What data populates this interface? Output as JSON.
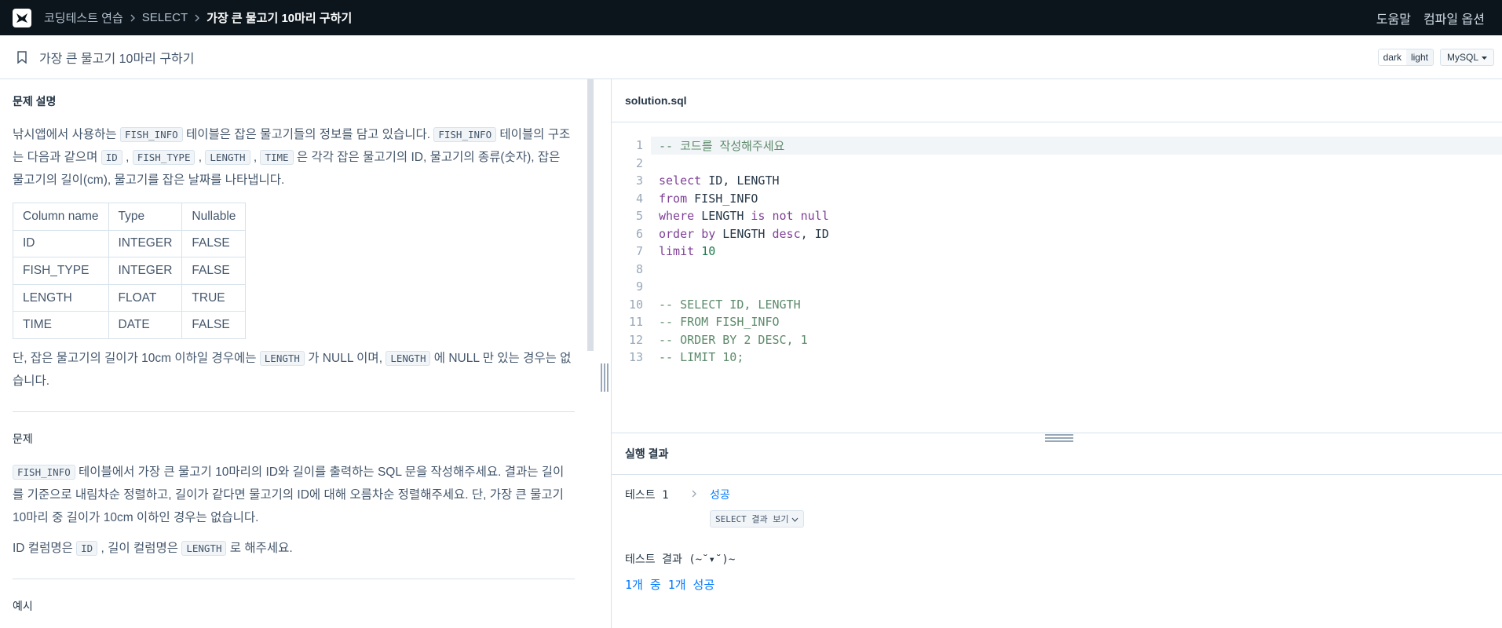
{
  "nav": {
    "breadcrumbs": [
      "코딩테스트 연습",
      "SELECT",
      "가장 큰 물고기 10마리 구하기"
    ],
    "help": "도움말",
    "compile_options": "컴파일 옵션"
  },
  "titlebar": {
    "title": "가장 큰 물고기 10마리 구하기",
    "theme_dark": "dark",
    "theme_light": "light",
    "language": "MySQL"
  },
  "problem": {
    "section_desc": "문제 설명",
    "p1_a": "낚시앱에서 사용하는 ",
    "p1_code1": "FISH_INFO",
    "p1_b": " 테이블은 잡은 물고기들의 정보를 담고 있습니다. ",
    "p1_code2": "FISH_INFO",
    "p1_c": " 테이블의 구조는 다음과 같으며 ",
    "p1_code3": "ID",
    "p1_d": " , ",
    "p1_code4": "FISH_TYPE",
    "p1_e": " , ",
    "p1_code5": "LENGTH",
    "p1_f": " , ",
    "p1_code6": "TIME",
    "p1_g": " 은 각각 잡은 물고기의 ID, 물고기의 종류(숫자), 잡은 물고기의 길이(cm), 물고기를 잡은 날짜를 나타냅니다.",
    "table_headers": [
      "Column name",
      "Type",
      "Nullable"
    ],
    "table_rows": [
      [
        "ID",
        "INTEGER",
        "FALSE"
      ],
      [
        "FISH_TYPE",
        "INTEGER",
        "FALSE"
      ],
      [
        "LENGTH",
        "FLOAT",
        "TRUE"
      ],
      [
        "TIME",
        "DATE",
        "FALSE"
      ]
    ],
    "p2_a": "단, 잡은 물고기의 길이가 10cm 이하일 경우에는 ",
    "p2_code1": "LENGTH",
    "p2_b": " 가 NULL 이며, ",
    "p2_code2": "LENGTH",
    "p2_c": " 에 NULL 만 있는 경우는 없습니다.",
    "section_problem": "문제",
    "p3_code": "FISH_INFO",
    "p3_text": " 테이블에서 가장 큰 물고기 10마리의 ID와 길이를 출력하는 SQL 문을 작성해주세요. 결과는 길이를 기준으로 내림차순 정렬하고, 길이가 같다면 물고기의 ID에 대해 오름차순 정렬해주세요. 단, 가장 큰 물고기 10마리 중 길이가 10cm 이하인 경우는 없습니다.",
    "p4_a": "ID 컬럼명은 ",
    "p4_code1": "ID",
    "p4_b": " , 길이 컬럼명은 ",
    "p4_code2": "LENGTH",
    "p4_c": " 로 해주세요.",
    "section_example": "예시"
  },
  "editor": {
    "filename": "solution.sql",
    "lines": [
      {
        "n": "1",
        "text": "-- 코드를 작성해주세요"
      },
      {
        "n": "2",
        "text": ""
      },
      {
        "n": "3",
        "text": "select ID, LENGTH"
      },
      {
        "n": "4",
        "text": "from FISH_INFO"
      },
      {
        "n": "5",
        "text": "where LENGTH is not null"
      },
      {
        "n": "6",
        "text": "order by LENGTH desc, ID"
      },
      {
        "n": "7",
        "text": "limit 10"
      },
      {
        "n": "8",
        "text": ""
      },
      {
        "n": "9",
        "text": ""
      },
      {
        "n": "10",
        "text": "-- SELECT ID, LENGTH"
      },
      {
        "n": "11",
        "text": "-- FROM FISH_INFO"
      },
      {
        "n": "12",
        "text": "-- ORDER BY 2 DESC, 1"
      },
      {
        "n": "13",
        "text": "-- LIMIT 10;"
      }
    ]
  },
  "result": {
    "title": "실행 결과",
    "test_name": "테스트 1",
    "test_status": "성공",
    "view_button": "SELECT 결과 보기",
    "summary_title": "테스트 결과 (~˘▾˘)~",
    "summary": "1개 중 1개 성공"
  },
  "colors": {
    "nav_bg": "#0c151c",
    "success": "#0078ff",
    "comment": "#5c8a6a",
    "keyword": "#7f3f98",
    "number": "#1d7a4e"
  }
}
